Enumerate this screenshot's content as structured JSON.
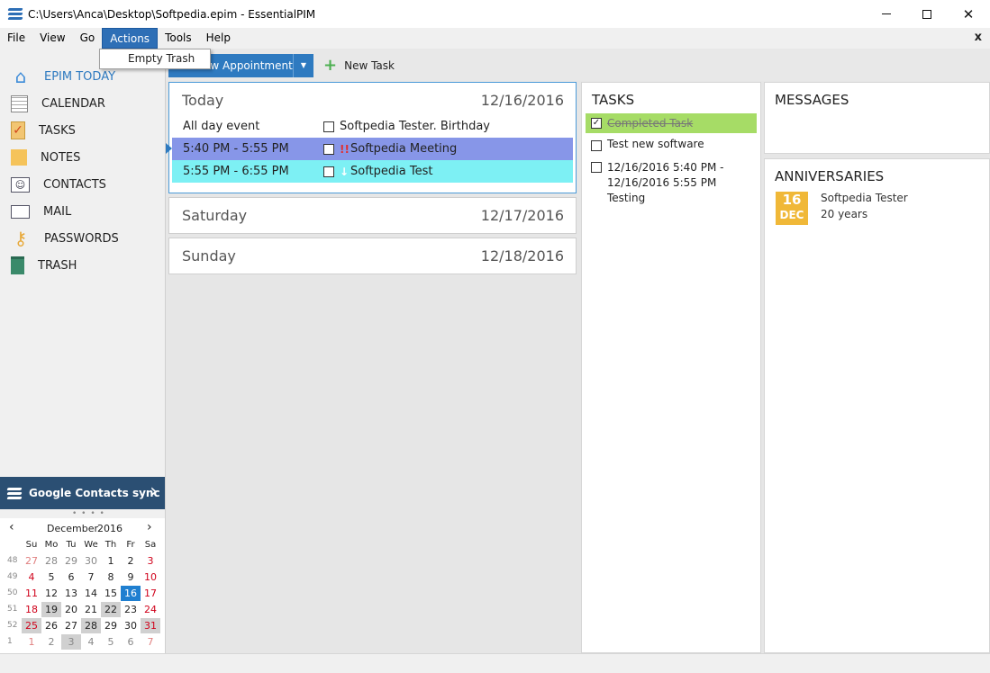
{
  "window": {
    "title": "C:\\Users\\Anca\\Desktop\\Softpedia.epim - EssentialPIM",
    "minimize": "—",
    "maximize": "☐",
    "close": "✕"
  },
  "menu": {
    "items": [
      "File",
      "View",
      "Go",
      "Actions",
      "Tools",
      "Help"
    ],
    "active": "Actions",
    "close_doc": "x",
    "dropdown": [
      "Empty Trash"
    ]
  },
  "toolbar": {
    "new_appointment": "New Appointment",
    "new_task": "New Task",
    "split_arrow": "▼"
  },
  "sidebar": {
    "items": [
      {
        "label": "EPIM TODAY",
        "icon": "home-icon",
        "selected": true
      },
      {
        "label": "CALENDAR",
        "icon": "calendar-icon"
      },
      {
        "label": "TASKS",
        "icon": "tasks-icon"
      },
      {
        "label": "NOTES",
        "icon": "notes-icon"
      },
      {
        "label": "CONTACTS",
        "icon": "contacts-icon"
      },
      {
        "label": "MAIL",
        "icon": "mail-icon"
      },
      {
        "label": "PASSWORDS",
        "icon": "key-icon"
      },
      {
        "label": "TRASH",
        "icon": "trash-icon"
      }
    ],
    "google_sync": "Google Contacts sync"
  },
  "minical": {
    "month": "December",
    "year": "2016",
    "prev": "‹",
    "next": "›",
    "dow": [
      "Su",
      "Mo",
      "Tu",
      "We",
      "Th",
      "Fr",
      "Sa"
    ],
    "weeks": [
      {
        "wk": "48",
        "days": [
          "27",
          "28",
          "29",
          "30",
          "1",
          "2",
          "3"
        ]
      },
      {
        "wk": "49",
        "days": [
          "4",
          "5",
          "6",
          "7",
          "8",
          "9",
          "10"
        ]
      },
      {
        "wk": "50",
        "days": [
          "11",
          "12",
          "13",
          "14",
          "15",
          "16",
          "17"
        ]
      },
      {
        "wk": "51",
        "days": [
          "18",
          "19",
          "20",
          "21",
          "22",
          "23",
          "24"
        ]
      },
      {
        "wk": "52",
        "days": [
          "25",
          "26",
          "27",
          "28",
          "29",
          "30",
          "31"
        ]
      },
      {
        "wk": "1",
        "days": [
          "1",
          "2",
          "3",
          "4",
          "5",
          "6",
          "7"
        ]
      }
    ]
  },
  "today": {
    "days": [
      {
        "name": "Today",
        "date": "12/16/2016"
      },
      {
        "name": "Saturday",
        "date": "12/17/2016"
      },
      {
        "name": "Sunday",
        "date": "12/18/2016"
      }
    ],
    "events": [
      {
        "time": "All day event",
        "title": "Softpedia Tester. Birthday",
        "priority": ""
      },
      {
        "time": "5:40 PM - 5:55 PM",
        "title": "Softpedia Meeting",
        "priority": "!!"
      },
      {
        "time": "5:55 PM - 6:55 PM",
        "title": "Softpedia Test",
        "priority": "↓"
      }
    ]
  },
  "tasks": {
    "title": "TASKS",
    "items": [
      {
        "label": "Completed Task",
        "done": true,
        "check": "✓"
      },
      {
        "label": "Test new software",
        "done": false
      },
      {
        "line1": "12/16/2016 5:40 PM -",
        "line2": "12/16/2016 5:55 PM",
        "line3": "Testing",
        "done": false
      }
    ]
  },
  "messages": {
    "title": "MESSAGES"
  },
  "anniversaries": {
    "title": "ANNIVERSARIES",
    "badge_day": "16",
    "badge_month": "DEC",
    "name": "Softpedia Tester",
    "years": "20 years"
  },
  "colors": {
    "accent": "#2e7ac0",
    "meeting": "#8796e8",
    "test": "#7df0f4",
    "completed": "#a6dc66",
    "badge": "#f0b838",
    "today_cell": "#1f7fd0"
  }
}
